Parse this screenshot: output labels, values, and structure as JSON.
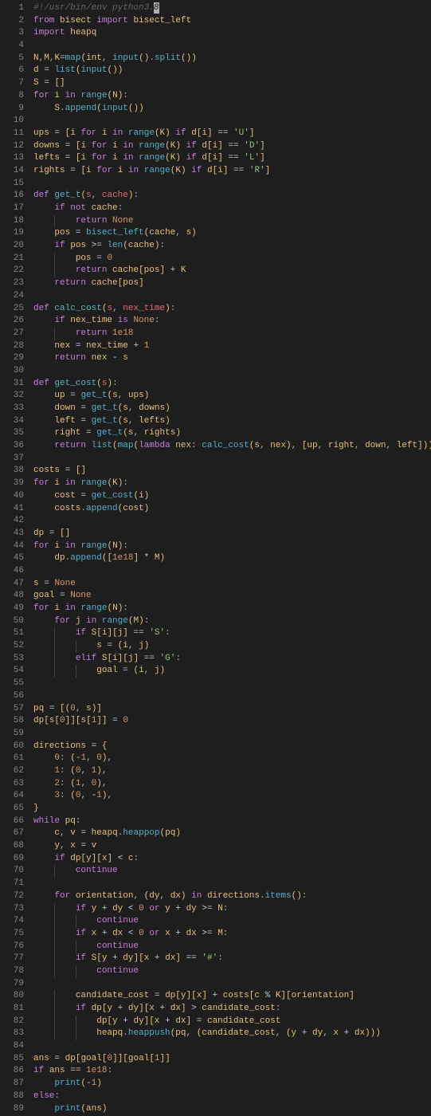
{
  "filename": "script.py",
  "language": "python",
  "cursor": {
    "line": 1,
    "col": 24
  },
  "colors": {
    "background": "#1e1e1e",
    "gutter": "#858585",
    "keyword": "#c57fdb",
    "function": "#54b0c9",
    "variable": "#e5c07b",
    "property": "#e06c75",
    "string": "#98c379",
    "number": "#d19a66",
    "comment": "#5c6370",
    "default": "#abb2bf"
  },
  "line_count": 89,
  "source_lines": [
    "#!/usr/bin/env python3.8",
    "from bisect import bisect_left",
    "import heapq",
    "",
    "N,M,K=map(int, input().split())",
    "d = list(input())",
    "S = []",
    "for i in range(N):",
    "    S.append(input())",
    "",
    "ups = [i for i in range(K) if d[i] == 'U']",
    "downs = [i for i in range(K) if d[i] == 'D']",
    "lefts = [i for i in range(K) if d[i] == 'L']",
    "rights = [i for i in range(K) if d[i] == 'R']",
    "",
    "def get_t(s, cache):",
    "    if not cache:",
    "        return None",
    "    pos = bisect_left(cache, s)",
    "    if pos >= len(cache):",
    "        pos = 0",
    "        return cache[pos] + K",
    "    return cache[pos]",
    "",
    "def calc_cost(s, nex_time):",
    "    if nex_time is None:",
    "        return 1e18",
    "    nex = nex_time + 1",
    "    return nex - s",
    "",
    "def get_cost(s):",
    "    up = get_t(s, ups)",
    "    down = get_t(s, downs)",
    "    left = get_t(s, lefts)",
    "    right = get_t(s, rights)",
    "    return list(map(lambda nex: calc_cost(s, nex), [up, right, down, left]))",
    "",
    "costs = []",
    "for i in range(K):",
    "    cost = get_cost(i)",
    "    costs.append(cost)",
    "",
    "dp = []",
    "for i in range(N):",
    "    dp.append([1e18] * M)",
    "",
    "s = None",
    "goal = None",
    "for i in range(N):",
    "    for j in range(M):",
    "        if S[i][j] == 'S':",
    "            s = (i, j)",
    "        elif S[i][j] == 'G':",
    "            goal = (i, j)",
    "",
    "",
    "pq = [(0, s)]",
    "dp[s[0]][s[1]] = 0",
    "",
    "directions = {",
    "    0: (-1, 0),",
    "    1: (0, 1),",
    "    2: (1, 0),",
    "    3: (0, -1),",
    "}",
    "while pq:",
    "    c, v = heapq.heappop(pq)",
    "    y, x = v",
    "    if dp[y][x] < c:",
    "        continue",
    "",
    "    for orientation, (dy, dx) in directions.items():",
    "        if y + dy < 0 or y + dy >= N:",
    "            continue",
    "        if x + dx < 0 or x + dx >= M:",
    "            continue",
    "        if S[y + dy][x + dx] == '#':",
    "            continue",
    "",
    "        candidate_cost = dp[y][x] + costs[c % K][orientation]",
    "        if dp[y + dy][x + dx] > candidate_cost:",
    "            dp[y + dy][x + dx] = candidate_cost",
    "            heapq.heappush(pq, (candidate_cost, (y + dy, x + dx)))",
    "",
    "ans = dp[goal[0]][goal[1]]",
    "if ans == 1e18:",
    "    print(-1)",
    "else:",
    "    print(ans)"
  ]
}
